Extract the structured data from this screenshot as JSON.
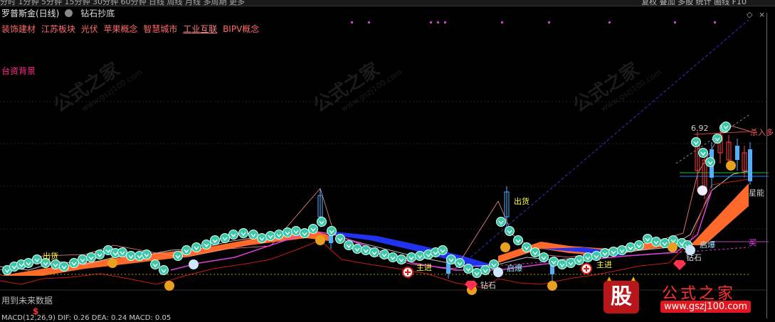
{
  "toolbar": {
    "periods": "分时  1分钟  5分钟  15分钟  30分钟  60分钟  日线  周线  月线  多周期  更多",
    "tools": "复权   叠加   多股   统计   画线   F10"
  },
  "header": {
    "stock_name": "罗普斯金(日线)",
    "indicator": "钻石抄底"
  },
  "concepts": [
    "装饰建材",
    "江苏板块",
    "光伏",
    "苹果概念",
    "智慧城市",
    "工业互联",
    "BIPV概念"
  ],
  "background_label": "台资背景",
  "footer": {
    "future_data": "用到未来数据",
    "dollar": "$",
    "macd": "MACD(12,26,9) DIF: 0.26  DEA: 0.24  MACD: 0.05"
  },
  "signals": {
    "chu_huo_1": "出货",
    "chu_huo_2": "出货",
    "zhu_jin_1": "主进",
    "zhu_jin_2": "主进",
    "qi_bao_1": "启爆",
    "qi_bao_2": "启爆",
    "zuan_shi_1": "钻石",
    "zuan_shi_2": "钻石",
    "kill_in": "杀入多",
    "buy": "买",
    "price_high": "6.92",
    "xing_neng": "星能"
  },
  "watermark": {
    "text": "公式之家",
    "url": "www.gszj100.com"
  },
  "logo": {
    "char": "股",
    "name": "公式之家",
    "url": "www.gszj100.com"
  }
}
